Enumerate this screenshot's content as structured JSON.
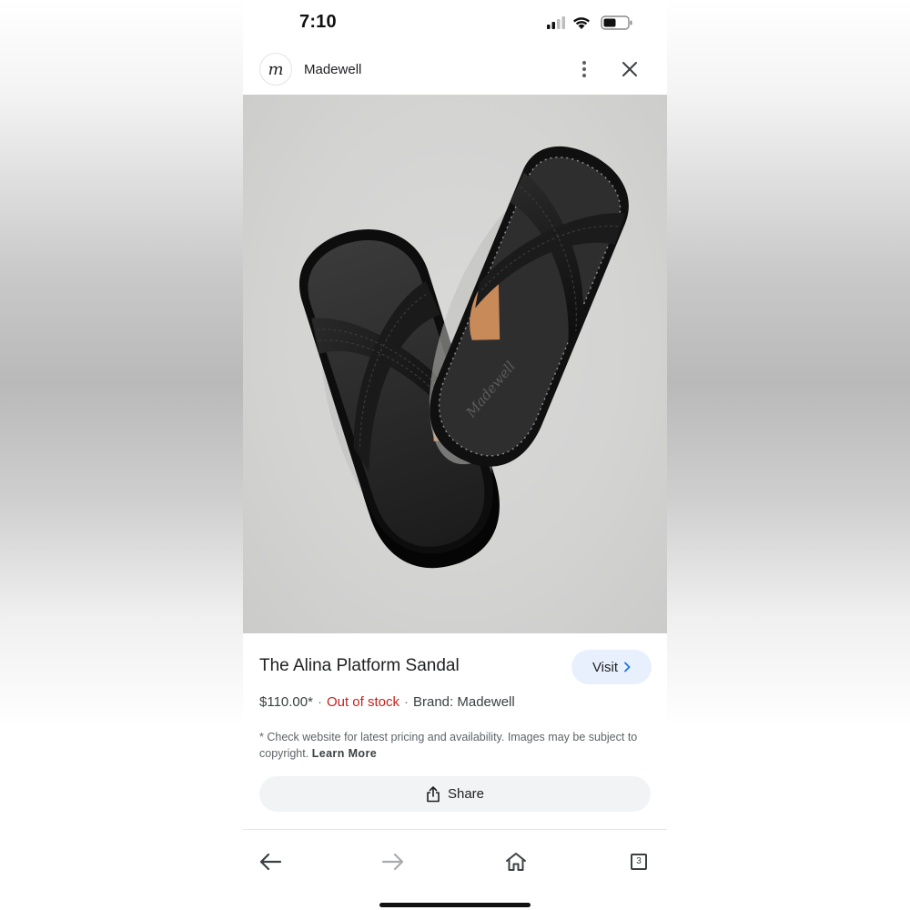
{
  "status_bar": {
    "time": "7:10",
    "icons": [
      "cellular-signal-icon",
      "wifi-icon",
      "battery-icon"
    ]
  },
  "header": {
    "site_logo_letter": "m",
    "site_name": "Madewell",
    "icons": [
      "more-vertical-icon",
      "close-icon"
    ]
  },
  "product": {
    "image_icon": "sandal-pair-image",
    "insole_brand_mark": "Madewell",
    "title": "The Alina Platform Sandal",
    "visit_label": "Visit",
    "price": "$110.00*",
    "stock_status": "Out of stock",
    "brand": "Brand: Madewell",
    "disclaimer": "* Check website for latest pricing and availability. Images may be subject to copyright.",
    "learn_more": "Learn More",
    "share_label": "Share"
  },
  "bottom_nav": {
    "items": [
      "back-arrow-icon",
      "forward-arrow-icon",
      "home-icon",
      "tabs-icon"
    ],
    "tab_count": "3"
  },
  "colors": {
    "out_of_stock": "#c5221f",
    "visit_button_bg": "#e8f0fe",
    "share_button_bg": "#f1f3f4",
    "image_bg": "#d3d3d2"
  }
}
